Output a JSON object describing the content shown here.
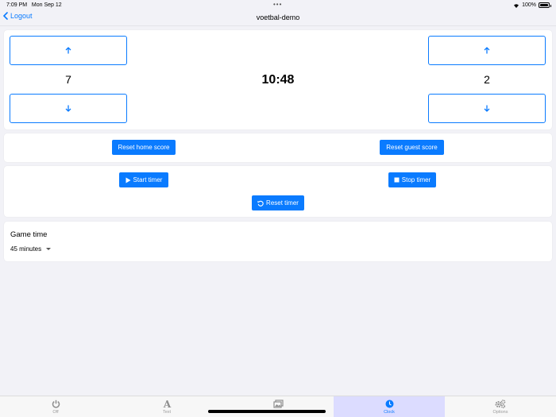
{
  "status_bar": {
    "time": "7:09 PM",
    "date": "Mon Sep 12",
    "battery": "100%"
  },
  "nav": {
    "back_label": "Logout",
    "title": "voetbal-demo"
  },
  "scoreboard": {
    "home_score": "7",
    "guest_score": "2",
    "clock": "10:48"
  },
  "score_actions": {
    "reset_home": "Reset home score",
    "reset_guest": "Reset guest score"
  },
  "timer_actions": {
    "start": "Start timer",
    "stop": "Stop timer",
    "reset": "Reset timer"
  },
  "game_time": {
    "label": "Game time",
    "selected": "45 minutes"
  },
  "tabs": [
    {
      "label": "Off",
      "icon": "power-icon"
    },
    {
      "label": "Text",
      "icon": "text-icon"
    },
    {
      "label": "",
      "icon": "images-icon"
    },
    {
      "label": "Clock",
      "icon": "clock-icon",
      "active": true
    },
    {
      "label": "Options",
      "icon": "gears-icon"
    }
  ],
  "colors": {
    "accent": "#0a7bff",
    "background": "#f2f2f7",
    "active_tab": "#dcdcff"
  }
}
